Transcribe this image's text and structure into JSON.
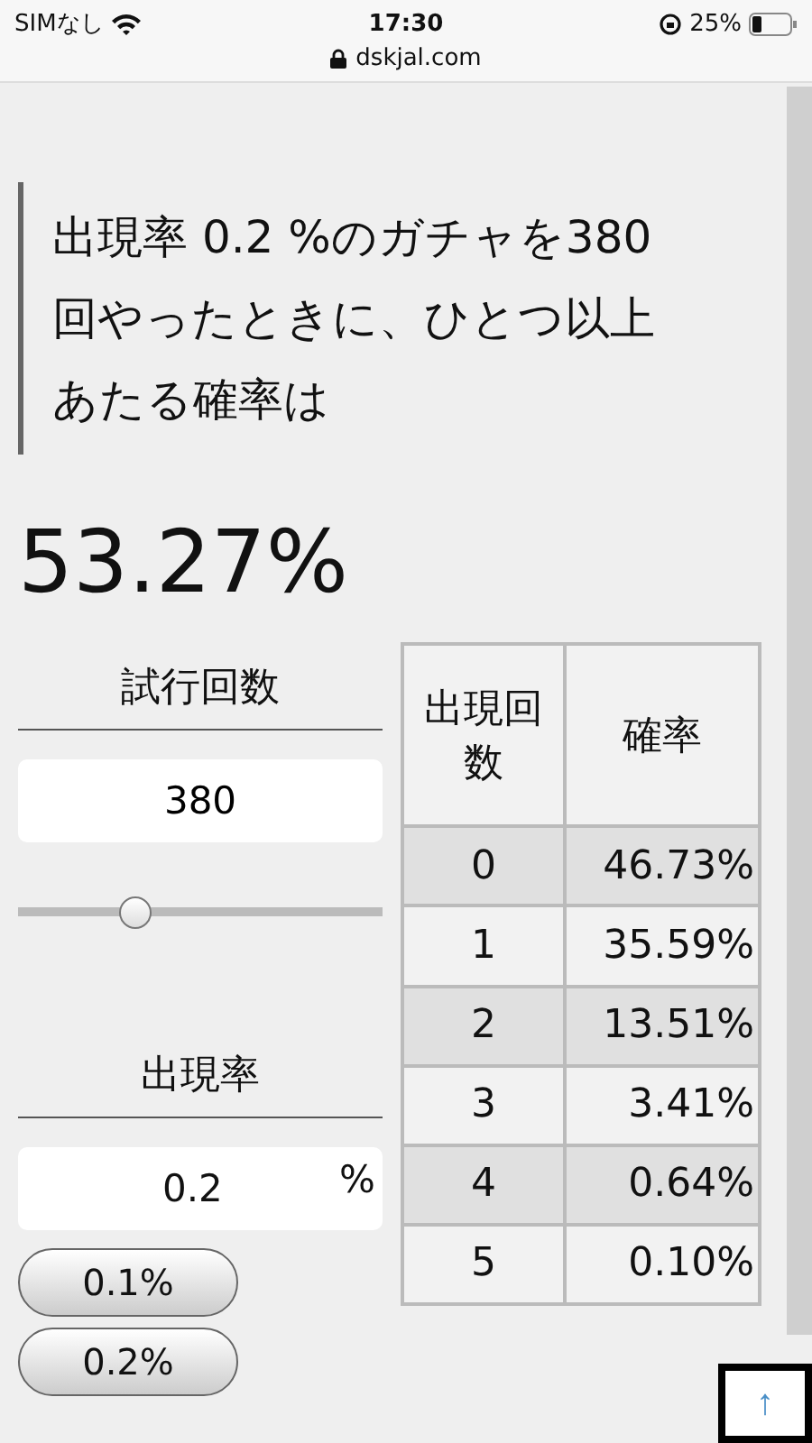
{
  "status_bar": {
    "carrier": "SIMなし",
    "time": "17:30",
    "url": "dskjal.com",
    "battery": "25%"
  },
  "question": "出現率 0.2 %のガチャを380 回やったときに、ひとつ以上あたる確率は",
  "result": "53.27%",
  "trials": {
    "label": "試行回数",
    "value": "380",
    "slider": {
      "level": 0.32
    }
  },
  "rate": {
    "label": "出現率",
    "value": "0.2",
    "unit": "%"
  },
  "presets": [
    "0.1%",
    "0.2%"
  ],
  "table": {
    "columns": [
      "出現回数",
      "確率"
    ],
    "rows": [
      [
        "0",
        "46.73%"
      ],
      [
        "1",
        "35.59%"
      ],
      [
        "2",
        "13.51%"
      ],
      [
        "3",
        "3.41%"
      ],
      [
        "4",
        "0.64%"
      ],
      [
        "5",
        "0.10%"
      ]
    ]
  },
  "top_button": "↑"
}
